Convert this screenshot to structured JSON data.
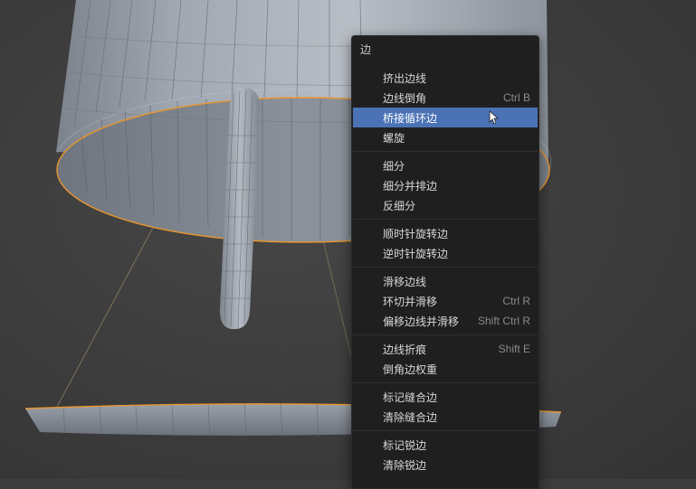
{
  "menu": {
    "title": "边",
    "groups": [
      [
        {
          "label": "挤出边线",
          "shortcut": ""
        },
        {
          "label": "边线倒角",
          "shortcut": "Ctrl B"
        },
        {
          "label": "桥接循环边",
          "shortcut": "",
          "active": true
        },
        {
          "label": "螺旋",
          "shortcut": ""
        }
      ],
      [
        {
          "label": "细分",
          "shortcut": ""
        },
        {
          "label": "细分并排边",
          "shortcut": ""
        },
        {
          "label": "反细分",
          "shortcut": ""
        }
      ],
      [
        {
          "label": "顺时针旋转边",
          "shortcut": ""
        },
        {
          "label": "逆时针旋转边",
          "shortcut": ""
        }
      ],
      [
        {
          "label": "滑移边线",
          "shortcut": ""
        },
        {
          "label": "环切并滑移",
          "shortcut": "Ctrl R"
        },
        {
          "label": "偏移边线并滑移",
          "shortcut": "Shift Ctrl R"
        }
      ],
      [
        {
          "label": "边线折痕",
          "shortcut": "Shift E"
        },
        {
          "label": "倒角边权重",
          "shortcut": ""
        }
      ],
      [
        {
          "label": "标记缝合边",
          "shortcut": ""
        },
        {
          "label": "清除缝合边",
          "shortcut": ""
        }
      ],
      [
        {
          "label": "标记锐边",
          "shortcut": ""
        },
        {
          "label": "清除锐边",
          "shortcut": ""
        }
      ]
    ]
  },
  "colors": {
    "accent": "#4a72b4",
    "selection_edge": "#e8962e",
    "menu_bg": "#1f1f1f"
  },
  "icons": {
    "cursor": "mouse-pointer-icon"
  }
}
